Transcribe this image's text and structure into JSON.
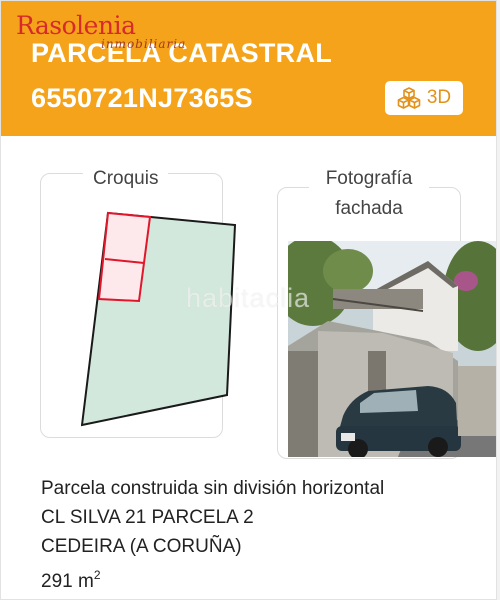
{
  "header": {
    "title_line1": "PARCELA CATASTRAL",
    "title_line2": "6550721NJ7365S",
    "btn_3d_label": "3D",
    "btn_3d_icon": "cubes-icon",
    "background": "#f5a31a"
  },
  "watermark": {
    "brand": "Rasolenia",
    "sub": "inmobiliaria"
  },
  "croquis": {
    "label": "Croquis",
    "parcel_fill": "#d3e8dc",
    "building_fill": "#fde9ec",
    "building_stroke": "#e0162b"
  },
  "fotografia": {
    "label": "Fotografía fachada",
    "watermark": "habitaclia"
  },
  "info": {
    "line1": "Parcela construida sin división horizontal",
    "line2": "CL SILVA 21 PARCELA 2",
    "line3": "CEDEIRA (A CORUÑA)",
    "area_value": "291 m",
    "area_unit_sup": "2"
  }
}
